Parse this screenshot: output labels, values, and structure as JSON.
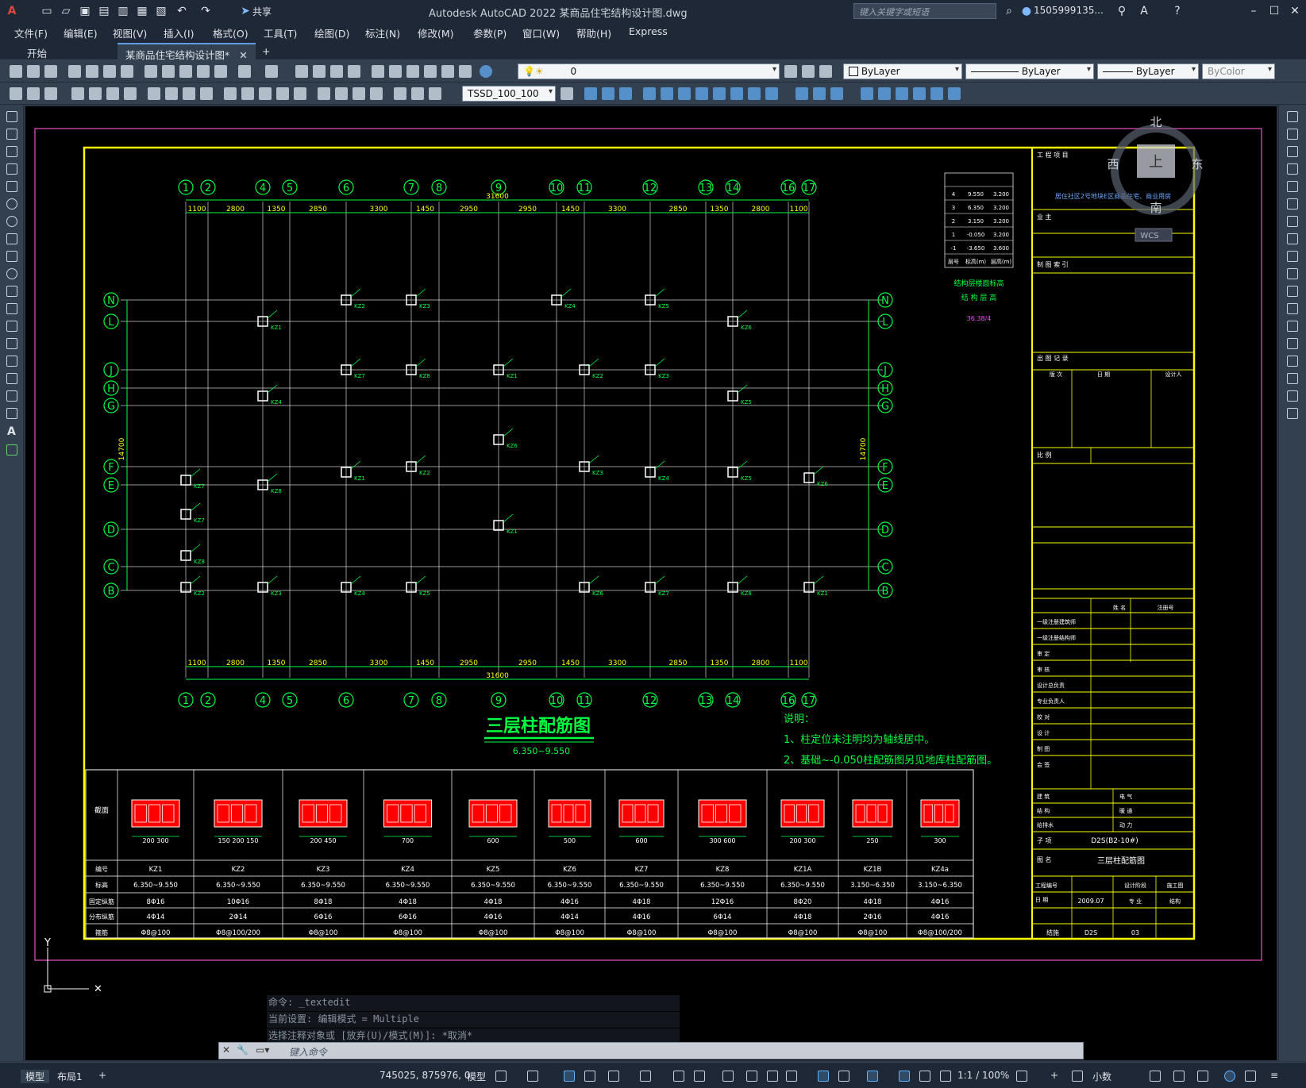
{
  "titlebar": {
    "app_title": "Autodesk AutoCAD 2022    某商品住宅结构设计图.dwg",
    "share_label": "共享",
    "search_placeholder": "键入关键字或短语",
    "user_name": "1505999135..."
  },
  "menu": [
    "文件(F)",
    "编辑(E)",
    "视图(V)",
    "插入(I)",
    "格式(O)",
    "工具(T)",
    "绘图(D)",
    "标注(N)",
    "修改(M)",
    "参数(P)",
    "窗口(W)",
    "帮助(H)",
    "Express"
  ],
  "tabs": {
    "start": "开始",
    "active": "某商品住宅结构设计图*"
  },
  "toolbar": {
    "layer_value": "0",
    "color_value": "ByLayer",
    "linetype_value": "ByLayer",
    "lineweight_value": "ByLayer",
    "plotstyle_value": "ByColor",
    "dimstyle_value": "TSSD_100_100"
  },
  "viewcube": {
    "north": "北",
    "south": "南",
    "east": "东",
    "west": "西",
    "top": "上",
    "wcs": "WCS"
  },
  "drawing": {
    "grid_x_labels": [
      "1",
      "2",
      "4",
      "5",
      "6",
      "7",
      "8",
      "9",
      "10",
      "11",
      "12",
      "13",
      "14",
      "16",
      "17"
    ],
    "grid_y_labels": [
      "N",
      "L",
      "J",
      "H",
      "G",
      "F",
      "E",
      "D",
      "C",
      "B"
    ],
    "x_dims": [
      "1100",
      "2800",
      "1350",
      "2850",
      "3300",
      "1450",
      "2950",
      "2950",
      "1450",
      "3300",
      "2850",
      "1350",
      "2800",
      "1100"
    ],
    "total_x_dim": "31600",
    "total_y_dim": "14700",
    "title": "三层柱配筋图",
    "subtitle": "6.350~9.550",
    "notes_title": "说明：",
    "notes": [
      "1、柱定位未注明均为轴线居中。",
      "2、基础~-0.050柱配筋图另见地库柱配筋图。"
    ],
    "column_labels": [
      "KZ1",
      "KZ2",
      "KZ3",
      "KZ4",
      "KZ5",
      "KZ6",
      "KZ7",
      "KZ8"
    ]
  },
  "elevation_table": {
    "rows": [
      [
        "4",
        "9.550",
        "3.200"
      ],
      [
        "3",
        "6.350",
        "3.200"
      ],
      [
        "2",
        "3.150",
        "3.200"
      ],
      [
        "1",
        "-0.050",
        "3.200"
      ],
      [
        "-1",
        "-3.650",
        "3.600"
      ]
    ],
    "header": [
      "层号",
      "标高(m)",
      "层高(m)"
    ],
    "caption1": "结构层楼面标高",
    "caption2": "结 构 层 高",
    "note": "36.38/4"
  },
  "schedule": {
    "row_labels": [
      "截面",
      "编号",
      "标高",
      "固定纵筋",
      "分布纵筋",
      "箍筋"
    ],
    "columns": [
      {
        "id": "KZ1",
        "elev": "6.350~9.550",
        "fixed": "8Φ16",
        "dist": "4Φ14",
        "stirrup": "Φ8@100",
        "dims": "200  300"
      },
      {
        "id": "KZ2",
        "elev": "6.350~9.550",
        "fixed": "10Φ16",
        "dist": "2Φ14",
        "stirrup": "Φ8@100/200",
        "dims": "150 200 150"
      },
      {
        "id": "KZ3",
        "elev": "6.350~9.550",
        "fixed": "8Φ18",
        "dist": "6Φ16",
        "stirrup": "Φ8@100",
        "dims": "200  450"
      },
      {
        "id": "KZ4",
        "elev": "6.350~9.550",
        "fixed": "4Φ18",
        "dist": "6Φ16",
        "stirrup": "Φ8@100",
        "dims": "700"
      },
      {
        "id": "KZ5",
        "elev": "6.350~9.550",
        "fixed": "4Φ18",
        "dist": "4Φ16",
        "stirrup": "Φ8@100",
        "dims": "600"
      },
      {
        "id": "KZ6",
        "elev": "6.350~9.550",
        "fixed": "4Φ16",
        "dist": "4Φ14",
        "stirrup": "Φ8@100",
        "dims": "500"
      },
      {
        "id": "KZ7",
        "elev": "6.350~9.550",
        "fixed": "4Φ18",
        "dist": "4Φ16",
        "stirrup": "Φ8@100",
        "dims": "600"
      },
      {
        "id": "KZ8",
        "elev": "6.350~9.550",
        "fixed": "12Φ16",
        "dist": "6Φ14",
        "stirrup": "Φ8@100",
        "dims": "300  600"
      },
      {
        "id": "KZ1A",
        "elev": "6.350~9.550",
        "fixed": "8Φ20",
        "dist": "4Φ18",
        "stirrup": "Φ8@100",
        "dims": "200  300"
      },
      {
        "id": "KZ1B",
        "elev": "3.150~6.350",
        "fixed": "4Φ18",
        "dist": "2Φ16",
        "stirrup": "Φ8@100",
        "dims": "250"
      },
      {
        "id": "KZ4a",
        "elev": "3.150~6.350",
        "fixed": "4Φ16",
        "dist": "4Φ16",
        "stirrup": "Φ8@100/200",
        "dims": "300"
      }
    ]
  },
  "title_block": {
    "project_label": "工 程 项 目",
    "project_value": "居住社区2号地块E区商品住宅、商业用房",
    "client_label": "业 主",
    "legend_label": "制 图 索 引",
    "issue_label": "出 图 记 录",
    "issue_cols": [
      "版 次",
      "日 期",
      "设计人"
    ],
    "scale_label": "比 例",
    "sig_labels": [
      "姓 名",
      "注册号",
      "一级注册建筑师",
      "一级注册结构师",
      "审 定",
      "审 核",
      "设计总负责",
      "专业负责人",
      "校 对",
      "设 计",
      "制 图",
      "会 签"
    ],
    "disciplines": [
      "建 筑",
      "电 气",
      "结 构",
      "暖 通",
      "给排水",
      "动 力"
    ],
    "subject_label": "子 项",
    "subject_value": "D2S(B2-10#)",
    "drawing_title_label": "图 名",
    "drawing_title_value": "三层柱配筋图",
    "job_label": "工程编号",
    "stage_label": "设计阶段",
    "stage_value": "施工图",
    "date_label": "日 期",
    "date_value": "2009.07",
    "discipline_label": "专 业",
    "discipline_value": "结构",
    "bottom": [
      "结施",
      "D2S",
      "03"
    ]
  },
  "command": {
    "history": [
      "命令: _textedit",
      "当前设置: 编辑模式 = Multiple",
      "选择注释对象或 [放弃(U)/模式(M)]: *取消*"
    ],
    "placeholder": "键入命令"
  },
  "status": {
    "tabs": [
      "模型",
      "布局1"
    ],
    "coords": "745025, 875976, 0",
    "model": "模型",
    "scale": "1:1 / 100%",
    "units": "小数"
  }
}
